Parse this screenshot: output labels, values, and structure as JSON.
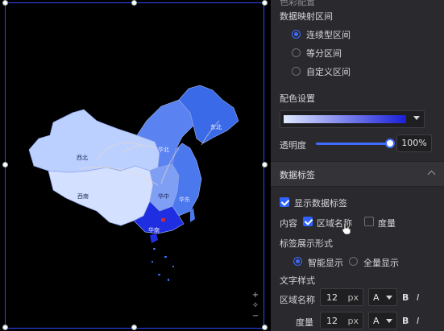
{
  "panel": {
    "color_config_heading": "色彩配置",
    "mapping_range_label": "数据映射区间",
    "mapping_options": [
      "连续型区间",
      "等分区间",
      "自定义区间"
    ],
    "mapping_selected": "连续型区间",
    "color_setting_label": "配色设置",
    "gradient_start": "#dfe8ff",
    "gradient_end": "#1a1fd8",
    "opacity_label": "透明度",
    "opacity_value": "100%",
    "opacity_fraction": 1.0,
    "data_label_section": "数据标签",
    "show_data_label": "显示数据标签",
    "content_label": "内容",
    "region_name_option": "区域名称",
    "measure_option": "度量",
    "label_form_label": "标签展示形式",
    "smart_display": "智能显示",
    "full_display": "全量显示",
    "text_style_label": "文字样式",
    "region_name_row_label": "区域名称",
    "measure_row_label": "度量",
    "font_size_region": "12",
    "font_size_measure": "12",
    "unit_px": "px",
    "font_letter": "A",
    "bold": "B",
    "italic": "I",
    "accent_color": "#2f63ff"
  },
  "map": {
    "region_labels": {
      "northwest": "西北",
      "north": "华北",
      "northeast": "东北",
      "southwest": "西南",
      "central": "华中",
      "east": "华东",
      "south": "华南"
    },
    "zoom_in": "+",
    "reset": "✧",
    "zoom_out": "−"
  }
}
